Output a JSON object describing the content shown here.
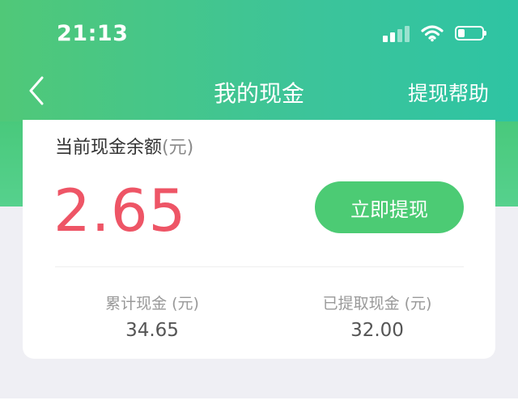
{
  "status_bar": {
    "time": "21:13",
    "icons": [
      "cellular-signal-icon",
      "wifi-icon",
      "battery-icon"
    ]
  },
  "nav": {
    "back_icon": "chevron-left-icon",
    "title": "我的现金",
    "help_label": "提现帮助"
  },
  "balance": {
    "label": "当前现金余额",
    "unit": "(元)",
    "value": "2.65",
    "withdraw_label": "立即提现"
  },
  "stats": {
    "total": {
      "label": "累计现金 (元)",
      "value": "34.65"
    },
    "withdrawn": {
      "label": "已提取现金 (元)",
      "value": "32.00"
    }
  },
  "colors": {
    "header_green": "#50c878",
    "header_teal": "#2ec4a3",
    "balance_red": "#ee5566",
    "button_green": "#4ccb74",
    "page_background": "#efeff4"
  }
}
